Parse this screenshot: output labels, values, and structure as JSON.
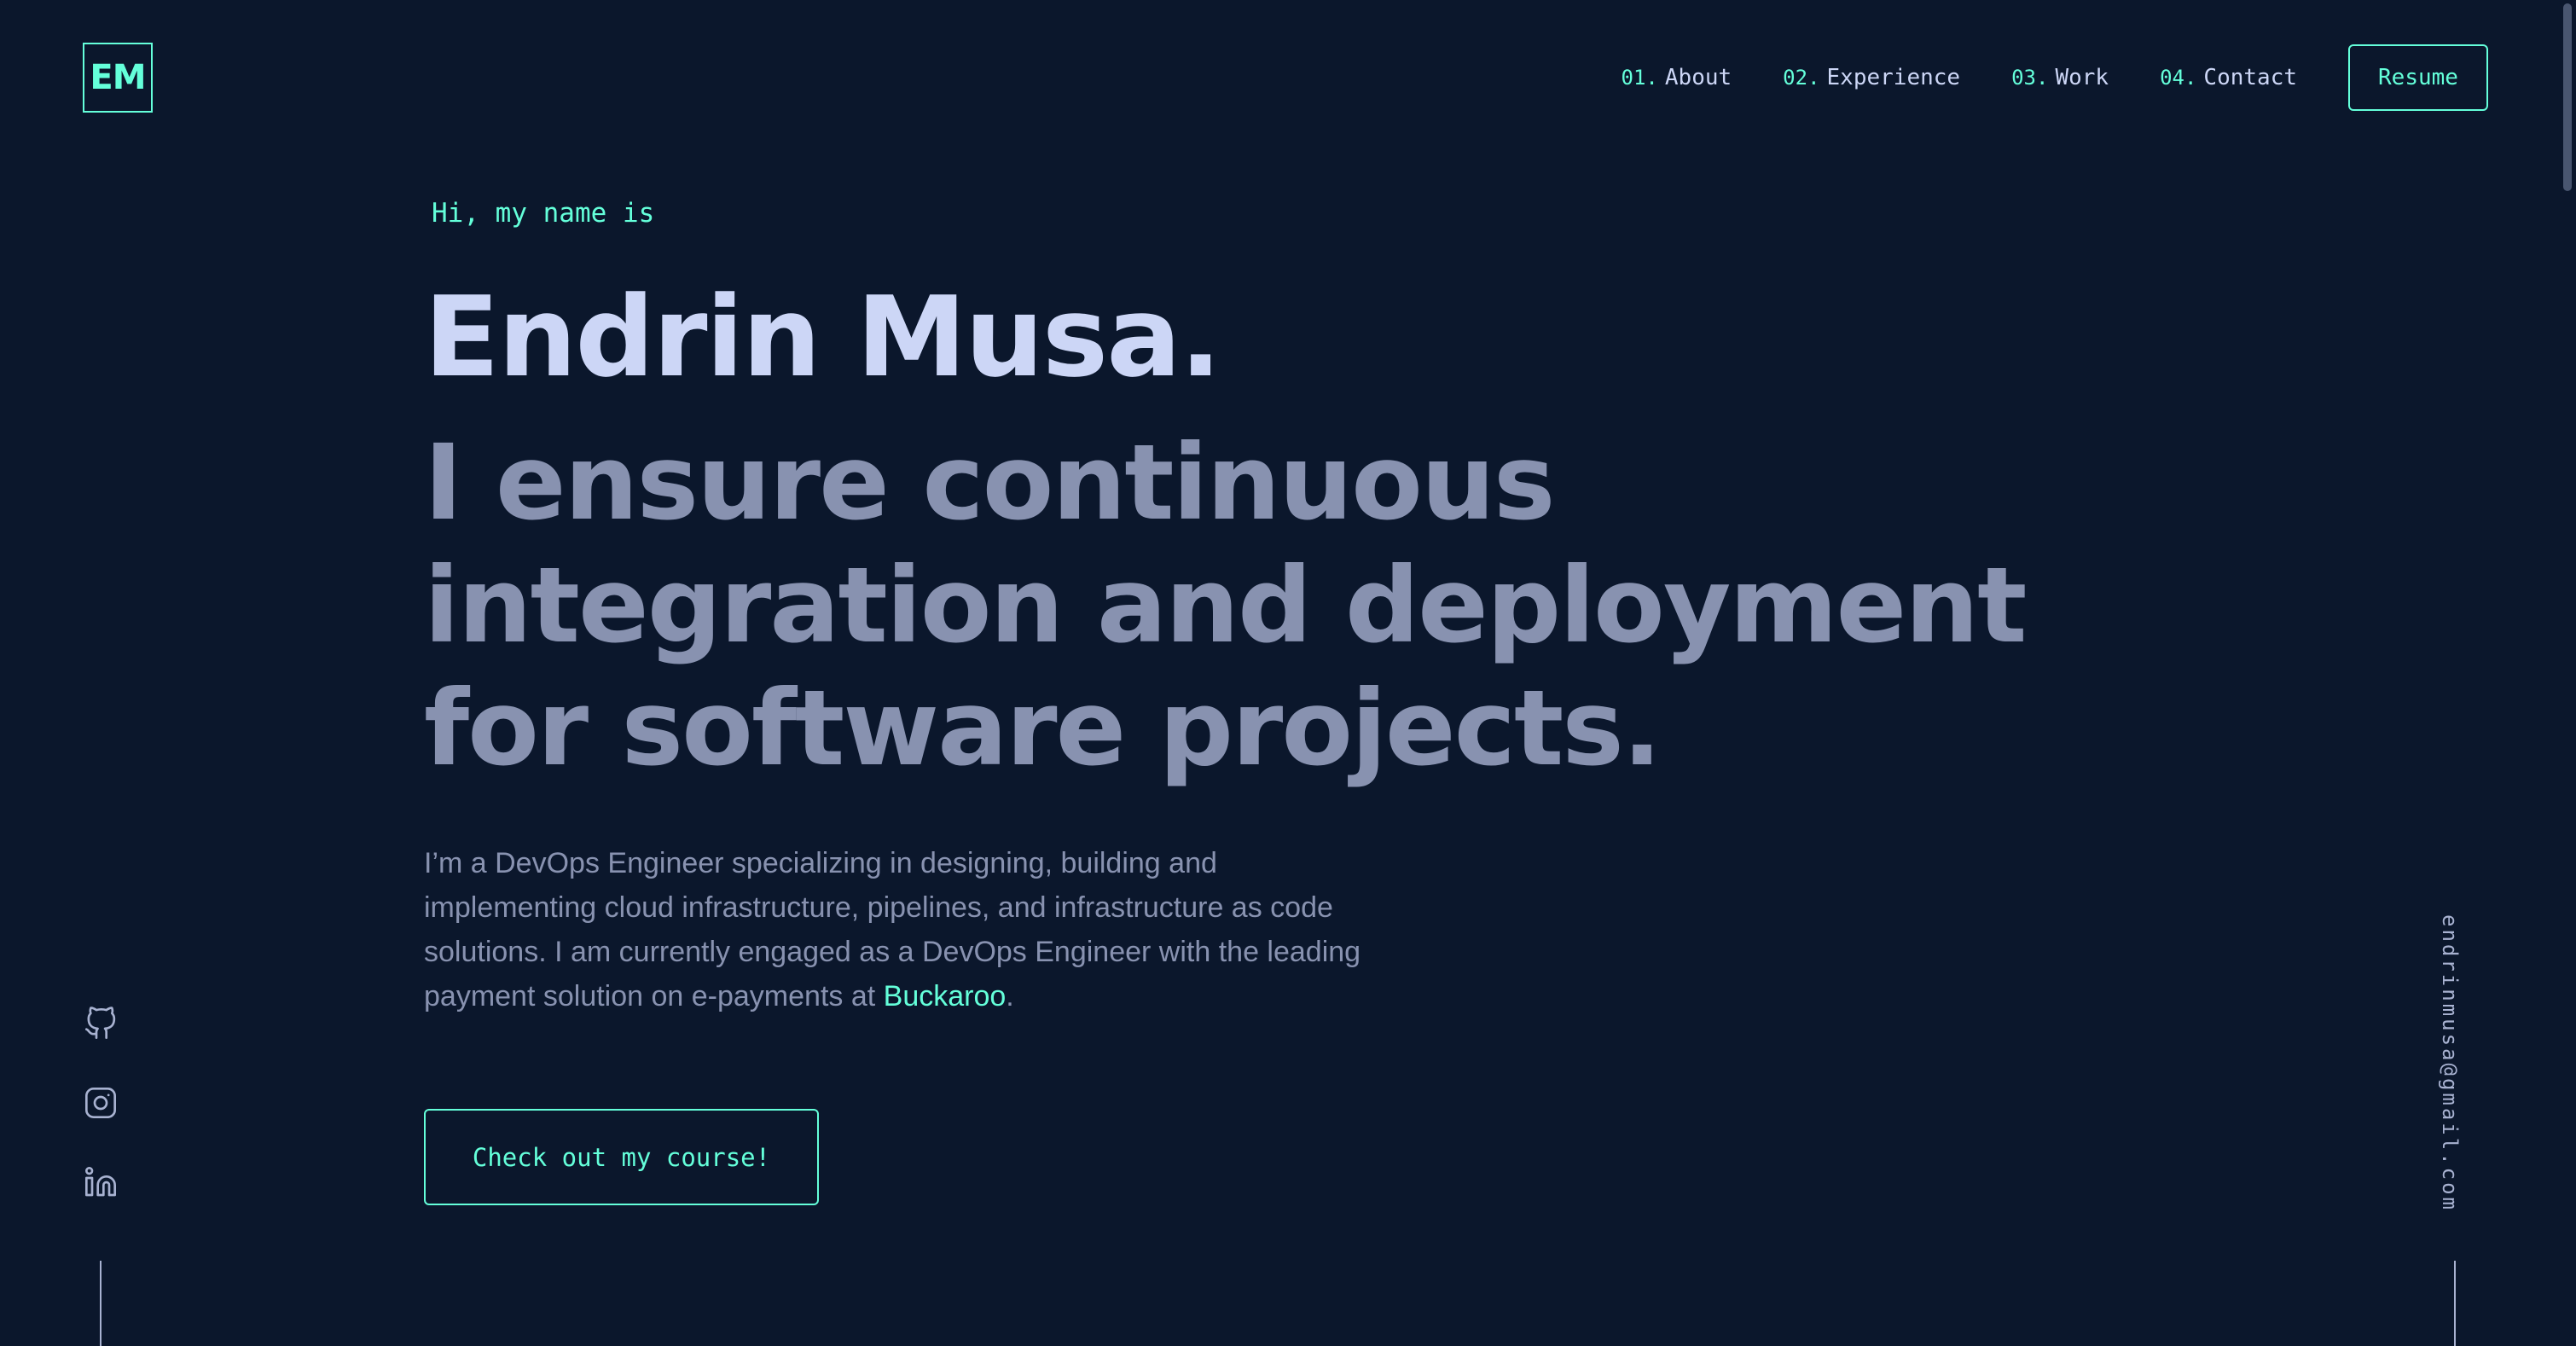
{
  "header": {
    "logo": "EM",
    "nav": [
      {
        "num": "01.",
        "label": "About"
      },
      {
        "num": "02.",
        "label": "Experience"
      },
      {
        "num": "03.",
        "label": "Work"
      },
      {
        "num": "04.",
        "label": "Contact"
      }
    ],
    "resume_label": "Resume"
  },
  "hero": {
    "greeting": "Hi, my name is",
    "name": "Endrin Musa.",
    "tagline": "I ensure continuous integration and deployment for software projects.",
    "intro_before": "I’m a DevOps Engineer specializing in designing, building and implementing cloud infrastructure, pipelines, and infrastructure as code solutions. I am currently engaged as a DevOps Engineer with the leading payment solution on e-payments at ",
    "intro_link": "Buckaroo",
    "intro_after": ".",
    "cta_label": "Check out my course!"
  },
  "social": {
    "icons": [
      "github-icon",
      "instagram-icon",
      "linkedin-icon"
    ]
  },
  "email": "endrinmusa@gmail.com",
  "colors": {
    "background": "#0b172c",
    "accent": "#64ffda",
    "heading": "#ccd6f6",
    "muted": "#8892b0"
  }
}
